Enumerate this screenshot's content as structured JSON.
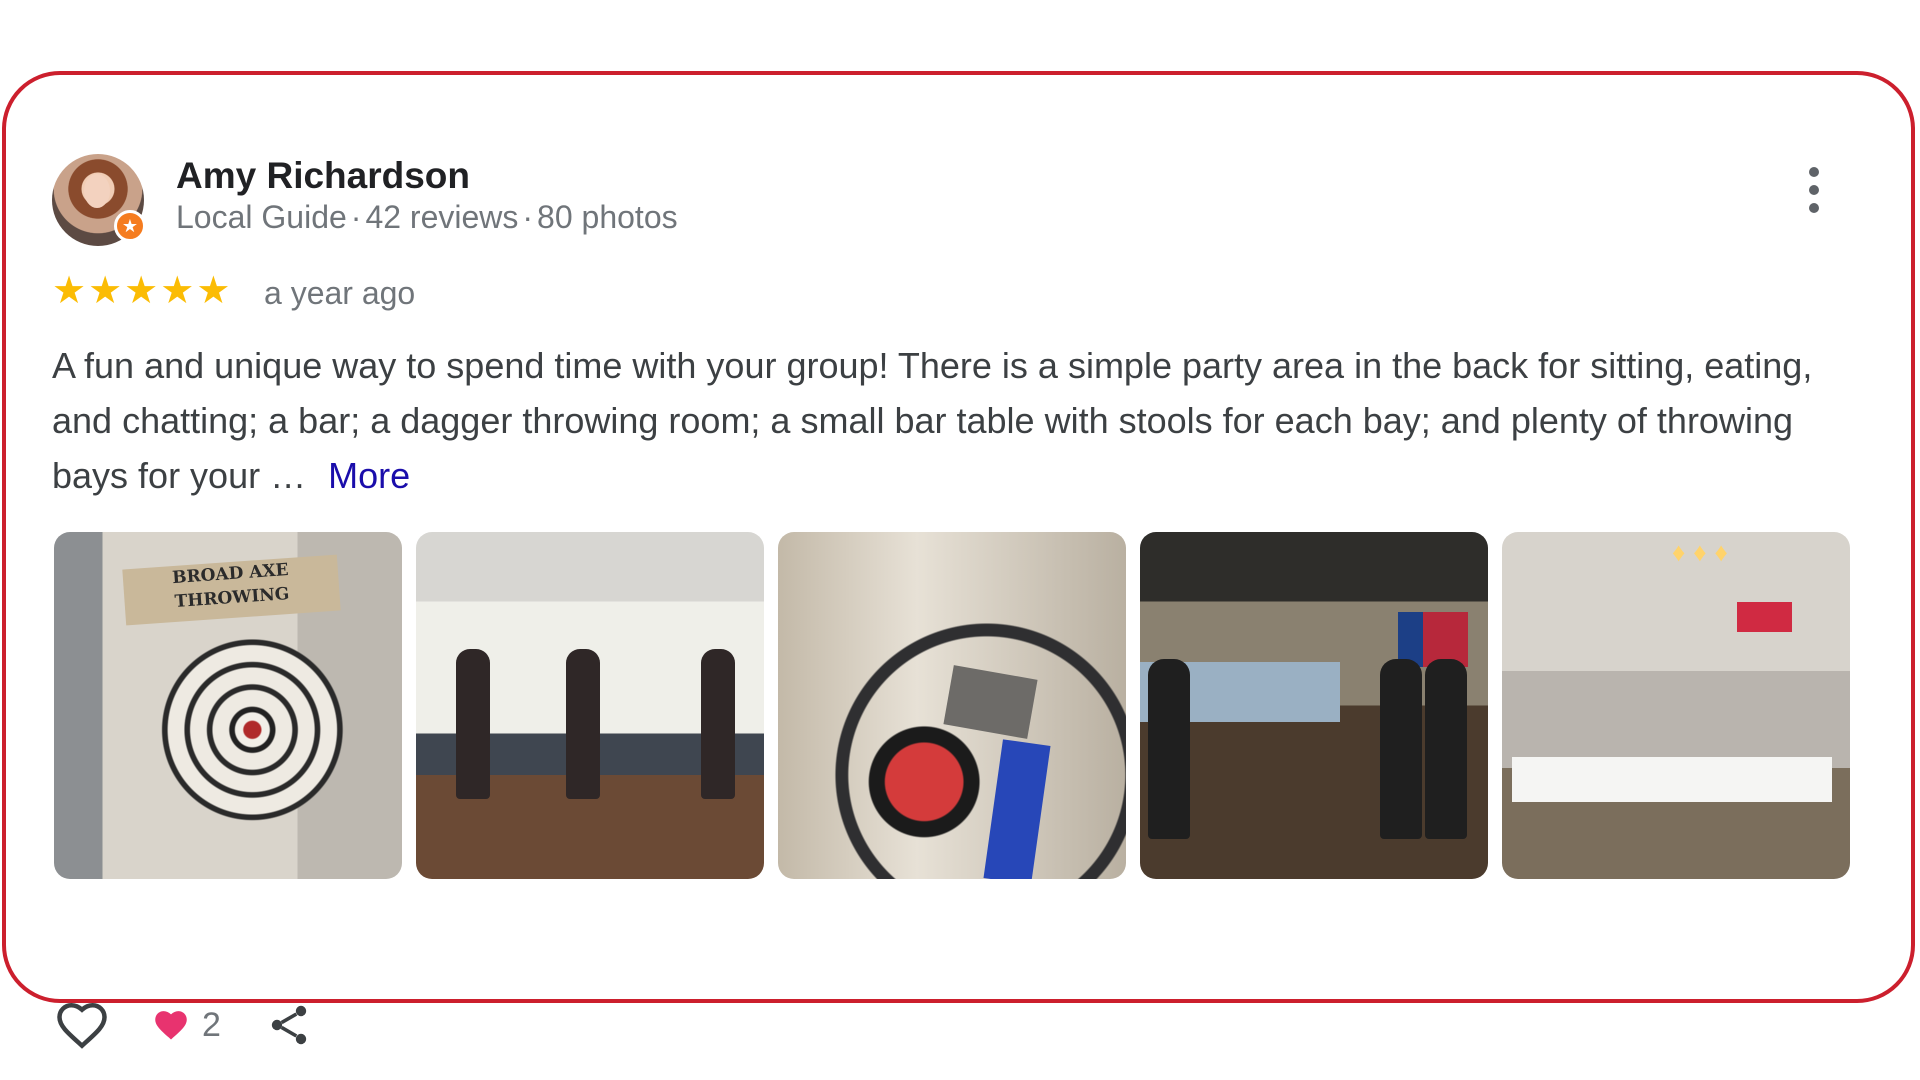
{
  "reviewer": {
    "name": "Amy Richardson",
    "badge": "Local Guide",
    "reviews": "42 reviews",
    "photos": "80 photos",
    "separator": "·"
  },
  "rating": {
    "stars": 5,
    "age": "a year ago"
  },
  "review": {
    "text": "A fun and unique way to spend time with your group! There is a simple party area in the back for sitting, eating, and chatting; a bar; a dagger throwing room; a small bar table with stools for each bay; and plenty of throwing bays for your …",
    "more_label": "More"
  },
  "photos": {
    "sign_text": "BROAD AXE THROWING"
  },
  "actions": {
    "reaction_count": "2"
  },
  "icons": {
    "menu": "more-vert-icon",
    "like": "heart-outline-icon",
    "reaction": "heart-filled-icon",
    "share": "share-icon"
  },
  "colors": {
    "border": "#cc1f2d",
    "star": "#fbbc04",
    "link": "#1a0dab",
    "reaction": "#e8336f"
  }
}
